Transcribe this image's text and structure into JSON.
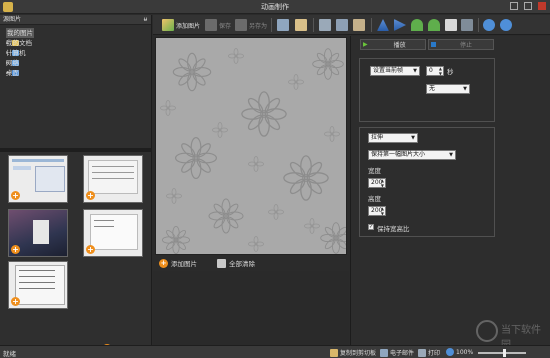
{
  "window": {
    "title": "动画制作"
  },
  "left": {
    "header": "源图片",
    "pin_glyph": "ᵾ",
    "tree": [
      {
        "label": "我的图片",
        "color": "#e8c55b",
        "selected": true
      },
      {
        "label": "我的文档",
        "color": "#e8c55b",
        "selected": false
      },
      {
        "label": "计算机",
        "color": "#6aa8e6",
        "selected": false
      },
      {
        "label": "网络",
        "color": "#6aa8e6",
        "selected": false
      },
      {
        "label": "桌面",
        "color": "#4a8fdc",
        "selected": false
      }
    ],
    "thumb_plus": "+"
  },
  "toolbar": {
    "add_image": "添加图片",
    "save": "保存",
    "save_as": "另存为"
  },
  "canvas": {
    "add_image": "添加图片",
    "clear_all": "全部清除",
    "plus": "+"
  },
  "right": {
    "play": "播放",
    "stop": "停止",
    "axis_select": "设置当前帧",
    "axis_value": "0",
    "seconds_label": "秒",
    "effect_select": "无",
    "stretch_select": "拉伸",
    "size_select": "保持第一幅图片大小",
    "width_label": "宽度",
    "width_value": "200",
    "height_label": "高度",
    "height_value": "200",
    "keep_ratio_label": "保持宽高比",
    "keep_ratio_checked": true
  },
  "status": {
    "text": "就绪",
    "copy": "复制到剪切板",
    "email": "电子邮件",
    "print": "打印",
    "zoom": "100%",
    "zoom_fraction": 0.55
  },
  "watermark": {
    "text": "当下软件园"
  },
  "colors": {
    "orange": "#ef8f1d",
    "green": "#6ac63a",
    "canvas_bg": "#aaaaaa"
  }
}
